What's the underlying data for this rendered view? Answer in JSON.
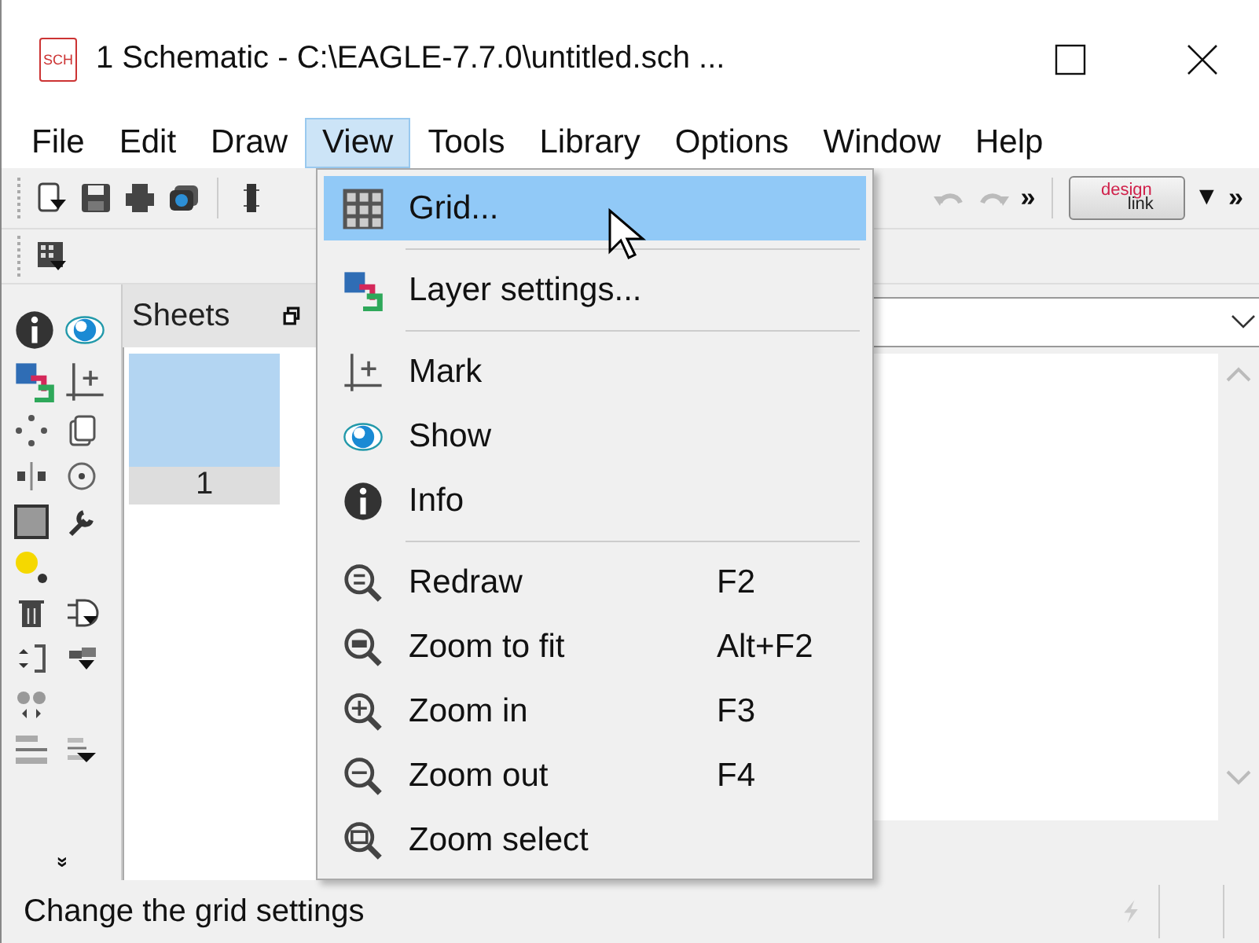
{
  "window": {
    "app_icon": "SCH",
    "title": "1 Schematic - C:\\EAGLE-7.7.0\\untitled.sch ..."
  },
  "menubar": [
    {
      "label": "File",
      "selected": false
    },
    {
      "label": "Edit",
      "selected": false
    },
    {
      "label": "Draw",
      "selected": false
    },
    {
      "label": "View",
      "selected": true
    },
    {
      "label": "Tools",
      "selected": false
    },
    {
      "label": "Library",
      "selected": false
    },
    {
      "label": "Options",
      "selected": false
    },
    {
      "label": "Window",
      "selected": false
    },
    {
      "label": "Help",
      "selected": false
    }
  ],
  "toolbar": {
    "overflow": "»",
    "designlink": [
      "design",
      "link"
    ],
    "caret": "▼",
    "overflow_2": "»"
  },
  "sidebar": {
    "more": "»"
  },
  "sheets": {
    "title": "Sheets",
    "items": [
      {
        "label": "1",
        "selected": true
      }
    ]
  },
  "view_menu": [
    {
      "kind": "item",
      "label": "Grid...",
      "selected": true
    },
    {
      "kind": "separator"
    },
    {
      "kind": "item",
      "label": "Layer settings...",
      "selected": false
    },
    {
      "kind": "separator"
    },
    {
      "kind": "item",
      "label": "Mark",
      "selected": false
    },
    {
      "kind": "item",
      "label": "Show",
      "selected": false
    },
    {
      "kind": "item",
      "label": "Info",
      "selected": false
    },
    {
      "kind": "separator"
    },
    {
      "kind": "item",
      "label": "Redraw",
      "shortcut": "F2",
      "selected": false
    },
    {
      "kind": "item",
      "label": "Zoom to fit",
      "shortcut": "Alt+F2",
      "selected": false
    },
    {
      "kind": "item",
      "label": "Zoom in",
      "shortcut": "F3",
      "selected": false
    },
    {
      "kind": "item",
      "label": "Zoom out",
      "shortcut": "F4",
      "selected": false
    },
    {
      "kind": "item",
      "label": "Zoom select",
      "selected": false
    }
  ],
  "status_bar": {
    "message": "Change the grid settings"
  }
}
